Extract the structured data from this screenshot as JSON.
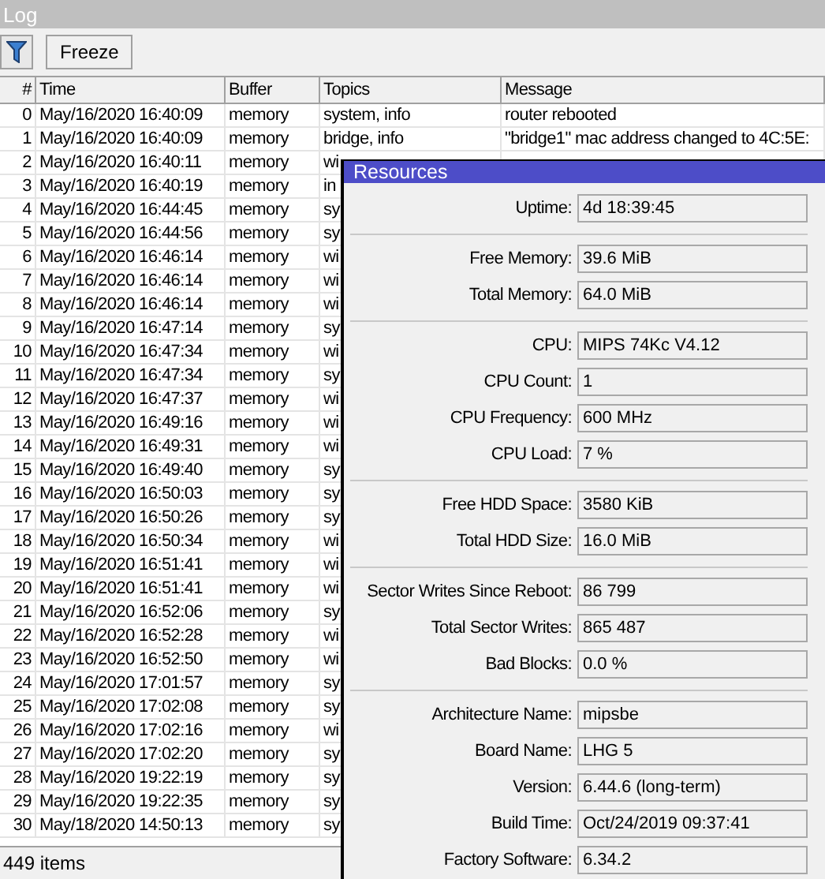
{
  "log": {
    "title": "Log",
    "toolbar": {
      "freeze_button": "Freeze"
    },
    "columns": [
      "#",
      "Time",
      "Buffer",
      "Topics",
      "Message"
    ],
    "rows": [
      {
        "n": "0",
        "time": "May/16/2020 16:40:09",
        "buffer": "memory",
        "topics": "system, info",
        "message": "router rebooted"
      },
      {
        "n": "1",
        "time": "May/16/2020 16:40:09",
        "buffer": "memory",
        "topics": "bridge, info",
        "message": "\"bridge1\" mac address changed to 4C:5E:"
      },
      {
        "n": "2",
        "time": "May/16/2020 16:40:11",
        "buffer": "memory",
        "topics": "wi"
      },
      {
        "n": "3",
        "time": "May/16/2020 16:40:19",
        "buffer": "memory",
        "topics": "in"
      },
      {
        "n": "4",
        "time": "May/16/2020 16:44:45",
        "buffer": "memory",
        "topics": "sy"
      },
      {
        "n": "5",
        "time": "May/16/2020 16:44:56",
        "buffer": "memory",
        "topics": "sy"
      },
      {
        "n": "6",
        "time": "May/16/2020 16:46:14",
        "buffer": "memory",
        "topics": "wi"
      },
      {
        "n": "7",
        "time": "May/16/2020 16:46:14",
        "buffer": "memory",
        "topics": "wi"
      },
      {
        "n": "8",
        "time": "May/16/2020 16:46:14",
        "buffer": "memory",
        "topics": "wi"
      },
      {
        "n": "9",
        "time": "May/16/2020 16:47:14",
        "buffer": "memory",
        "topics": "sy"
      },
      {
        "n": "10",
        "time": "May/16/2020 16:47:34",
        "buffer": "memory",
        "topics": "wi"
      },
      {
        "n": "11",
        "time": "May/16/2020 16:47:34",
        "buffer": "memory",
        "topics": "sy"
      },
      {
        "n": "12",
        "time": "May/16/2020 16:47:37",
        "buffer": "memory",
        "topics": "wi"
      },
      {
        "n": "13",
        "time": "May/16/2020 16:49:16",
        "buffer": "memory",
        "topics": "wi"
      },
      {
        "n": "14",
        "time": "May/16/2020 16:49:31",
        "buffer": "memory",
        "topics": "wi"
      },
      {
        "n": "15",
        "time": "May/16/2020 16:49:40",
        "buffer": "memory",
        "topics": "sy"
      },
      {
        "n": "16",
        "time": "May/16/2020 16:50:03",
        "buffer": "memory",
        "topics": "sy"
      },
      {
        "n": "17",
        "time": "May/16/2020 16:50:26",
        "buffer": "memory",
        "topics": "sy"
      },
      {
        "n": "18",
        "time": "May/16/2020 16:50:34",
        "buffer": "memory",
        "topics": "wi"
      },
      {
        "n": "19",
        "time": "May/16/2020 16:51:41",
        "buffer": "memory",
        "topics": "wi"
      },
      {
        "n": "20",
        "time": "May/16/2020 16:51:41",
        "buffer": "memory",
        "topics": "wi"
      },
      {
        "n": "21",
        "time": "May/16/2020 16:52:06",
        "buffer": "memory",
        "topics": "sy"
      },
      {
        "n": "22",
        "time": "May/16/2020 16:52:28",
        "buffer": "memory",
        "topics": "wi"
      },
      {
        "n": "23",
        "time": "May/16/2020 16:52:50",
        "buffer": "memory",
        "topics": "wi"
      },
      {
        "n": "24",
        "time": "May/16/2020 17:01:57",
        "buffer": "memory",
        "topics": "sy"
      },
      {
        "n": "25",
        "time": "May/16/2020 17:02:08",
        "buffer": "memory",
        "topics": "sy"
      },
      {
        "n": "26",
        "time": "May/16/2020 17:02:16",
        "buffer": "memory",
        "topics": "wi"
      },
      {
        "n": "27",
        "time": "May/16/2020 17:02:20",
        "buffer": "memory",
        "topics": "sy"
      },
      {
        "n": "28",
        "time": "May/16/2020 19:22:19",
        "buffer": "memory",
        "topics": "sy"
      },
      {
        "n": "29",
        "time": "May/16/2020 19:22:35",
        "buffer": "memory",
        "topics": "sy"
      },
      {
        "n": "30",
        "time": "May/18/2020 14:50:13",
        "buffer": "memory",
        "topics": "sy"
      }
    ],
    "status_bar": "449 items"
  },
  "resources": {
    "title": "Resources",
    "groups": [
      [
        {
          "label": "Uptime:",
          "value": "4d 18:39:45"
        }
      ],
      [
        {
          "label": "Free Memory:",
          "value": "39.6 MiB"
        },
        {
          "label": "Total Memory:",
          "value": "64.0 MiB"
        }
      ],
      [
        {
          "label": "CPU:",
          "value": "MIPS 74Kc V4.12"
        },
        {
          "label": "CPU Count:",
          "value": "1"
        },
        {
          "label": "CPU Frequency:",
          "value": "600 MHz"
        },
        {
          "label": "CPU Load:",
          "value": "7 %"
        }
      ],
      [
        {
          "label": "Free HDD Space:",
          "value": "3580 KiB"
        },
        {
          "label": "Total HDD Size:",
          "value": "16.0 MiB"
        }
      ],
      [
        {
          "label": "Sector Writes Since Reboot:",
          "value": "86 799"
        },
        {
          "label": "Total Sector Writes:",
          "value": "865 487"
        },
        {
          "label": "Bad Blocks:",
          "value": "0.0 %"
        }
      ],
      [
        {
          "label": "Architecture Name:",
          "value": "mipsbe"
        },
        {
          "label": "Board Name:",
          "value": "LHG 5"
        },
        {
          "label": "Version:",
          "value": "6.44.6 (long-term)"
        },
        {
          "label": "Build Time:",
          "value": "Oct/24/2019 09:37:41"
        },
        {
          "label": "Factory Software:",
          "value": "6.34.2"
        }
      ]
    ]
  }
}
